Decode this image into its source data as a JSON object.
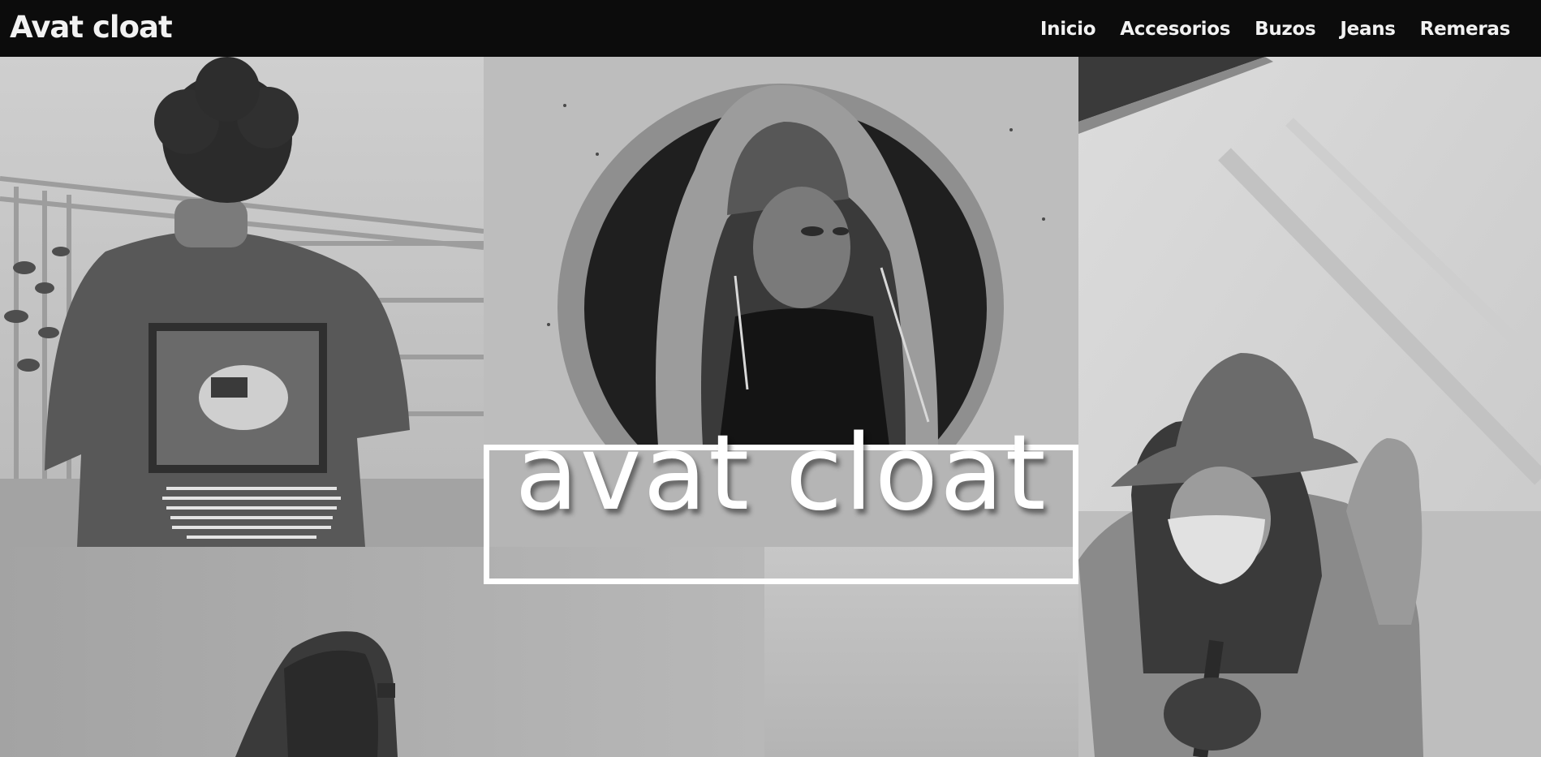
{
  "brand": {
    "name": "Avat cloat"
  },
  "nav": {
    "items": [
      {
        "label": "Inicio"
      },
      {
        "label": "Accesorios"
      },
      {
        "label": "Buzos"
      },
      {
        "label": "Jeans"
      },
      {
        "label": "Remeras"
      }
    ]
  },
  "hero": {
    "title": "avat cloat"
  },
  "gallery": {
    "photos": [
      {
        "subject": "man-back-graphic-tshirt-photo"
      },
      {
        "subject": "hooded-man-circular-window-photo"
      },
      {
        "subject": "woman-bucket-hat-mask-photo"
      },
      {
        "subject": "hooded-figure-foggy-photo"
      },
      {
        "subject": "foggy-sky-photo"
      }
    ],
    "tshirt_print_text": "Every day, people are making decisions for you, for your family, your children, for your friends, without your consent. These people have never met you, they don't care about you to them, you are nothing but a dollar sign,a vote, or a statistic. It is up to you, it is your responsibility, to be informed, to raise awareness, to keep them in check and hold them accountable. Empower yourself and others."
  },
  "colors": {
    "navbar_bg": "#0c0c0c",
    "nav_text": "#f2f2f2",
    "hero_text": "#ffffff"
  }
}
